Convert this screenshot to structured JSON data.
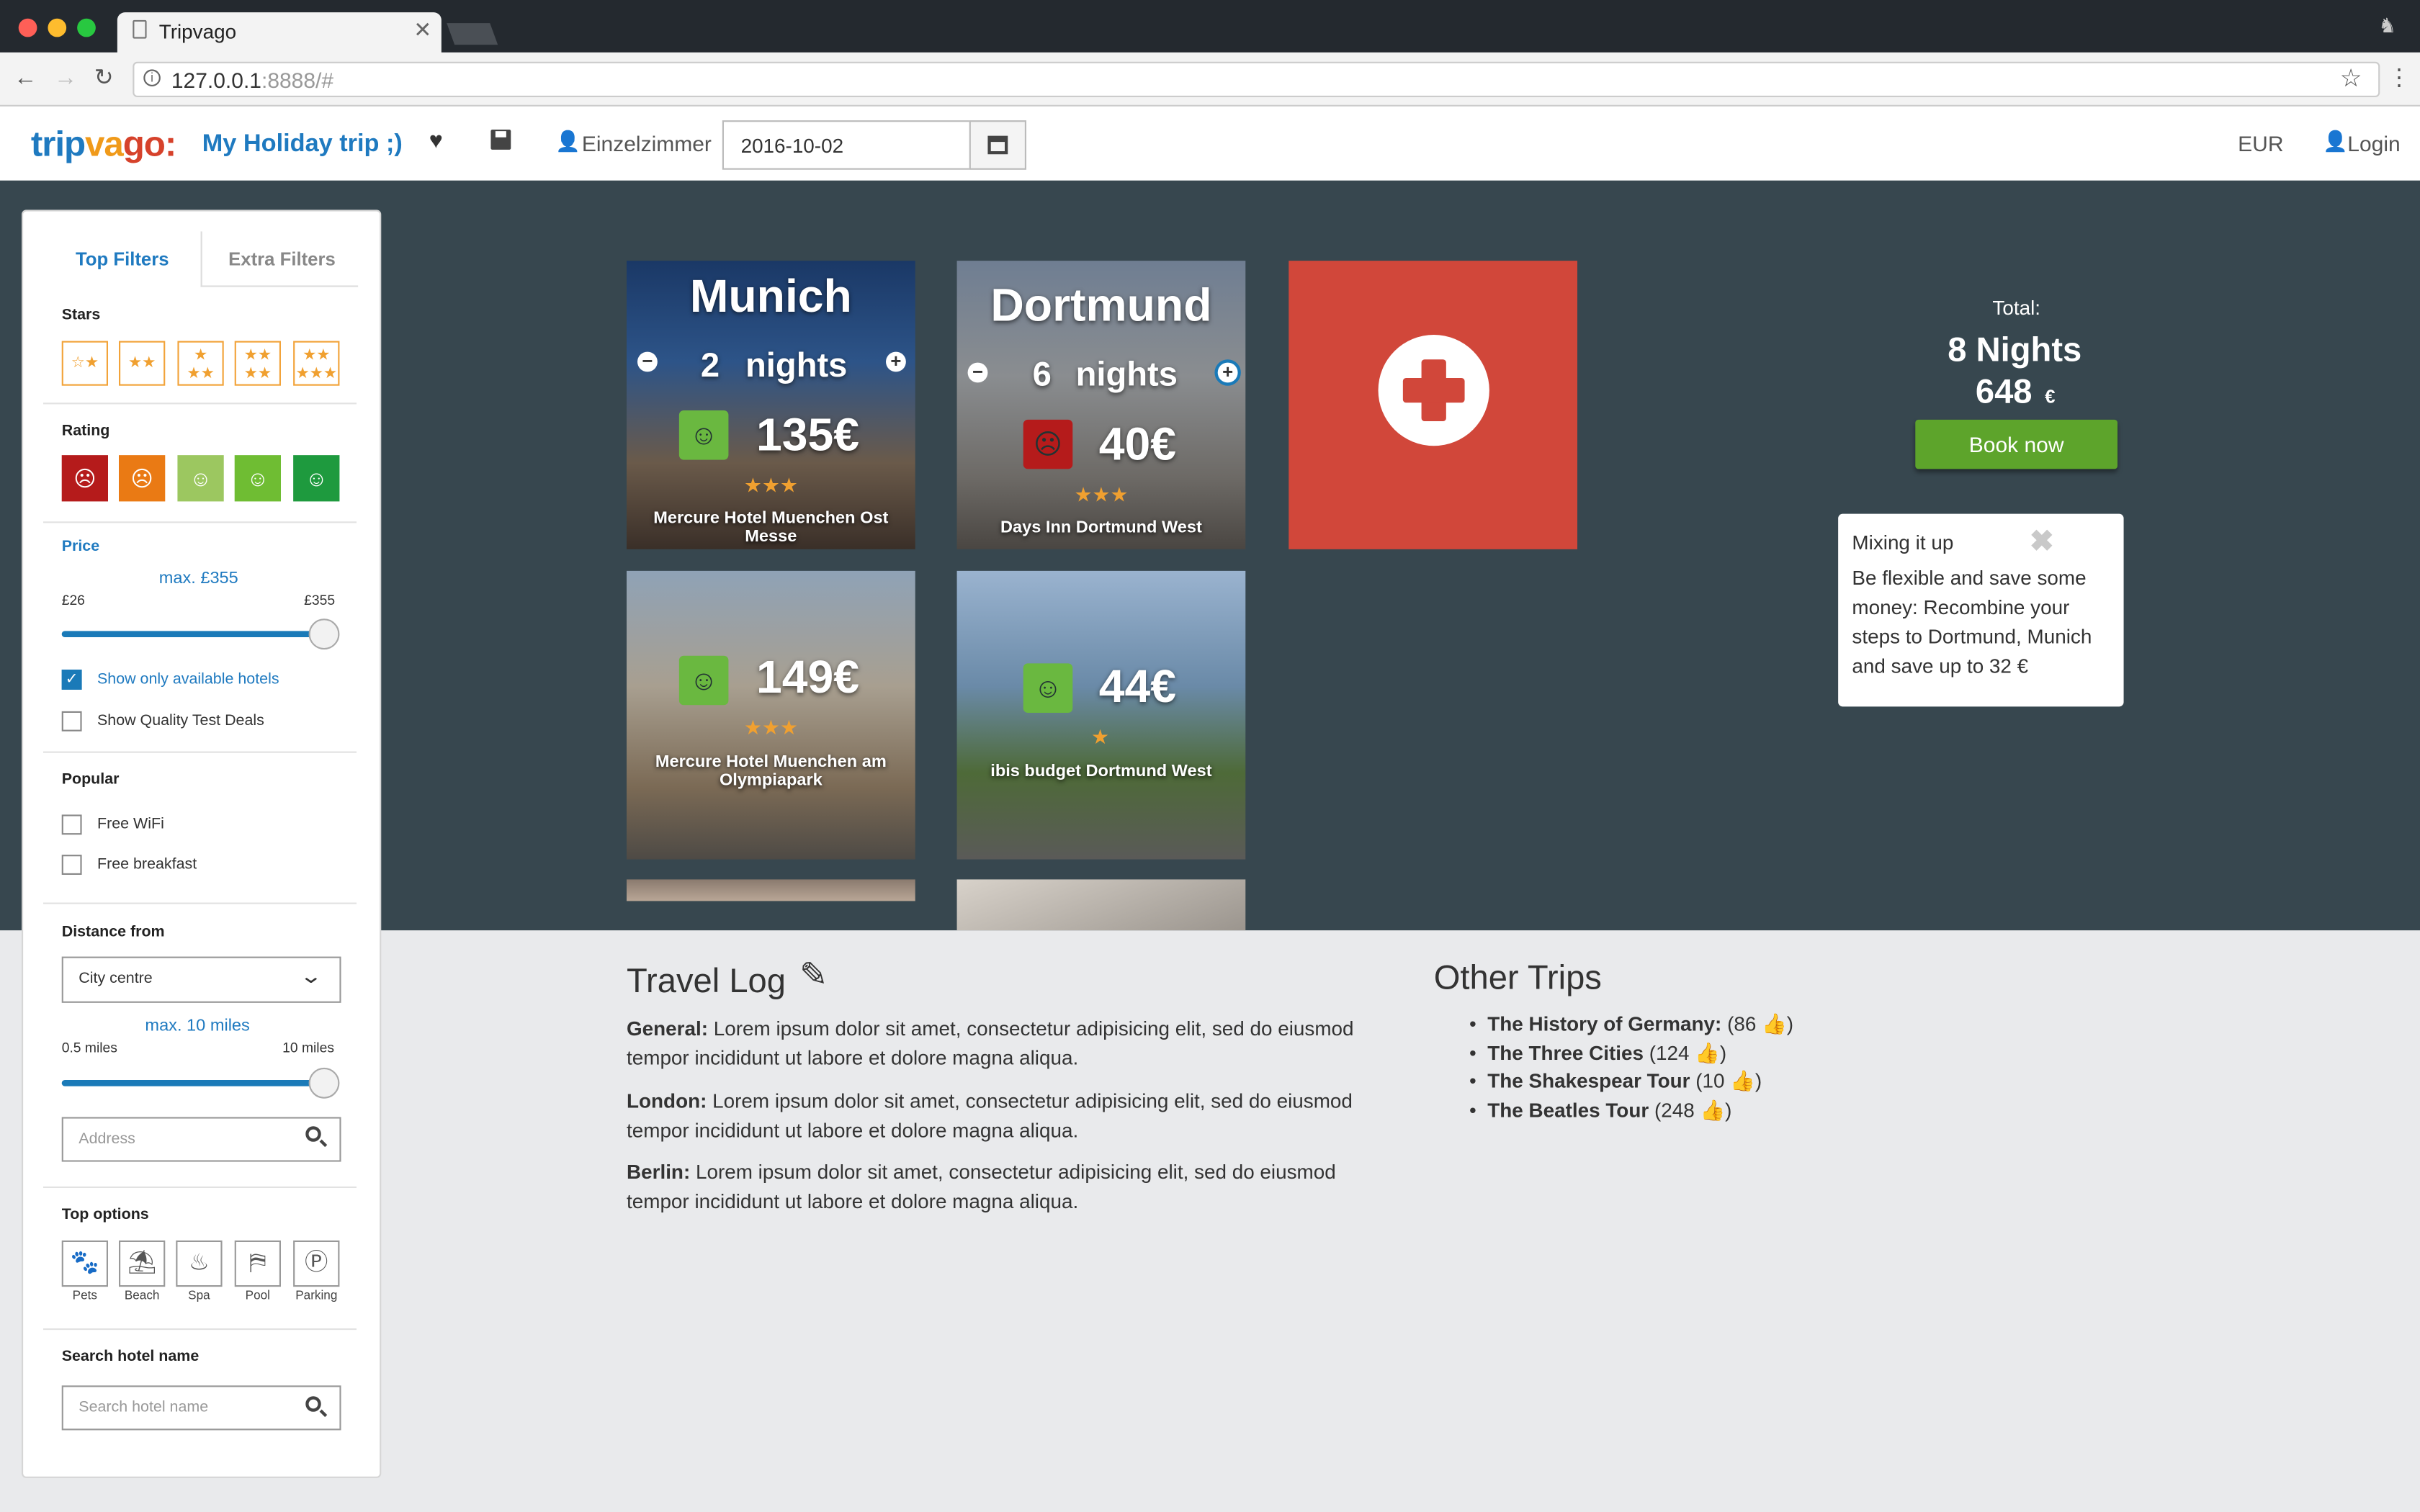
{
  "browser": {
    "tab_title": "Tripvago",
    "url_host": "127.0.0.1",
    "url_rest": ":8888/#"
  },
  "header": {
    "logo_parts": [
      "t",
      "r",
      "i",
      "p",
      "v",
      "a",
      "g",
      "o",
      ":"
    ],
    "logo_colors": [
      "#1f7ac0",
      "#1f7ac0",
      "#1f7ac0",
      "#1f7ac0",
      "#f09a1a",
      "#f09a1a",
      "#d6422b",
      "#d6422b",
      "#d6422b"
    ],
    "trip_title": "My Holiday trip ;)",
    "room_type": "Einzelzimmer",
    "date": "2016-10-02",
    "currency": "EUR",
    "login": "Login"
  },
  "sidebar": {
    "tab_top": "Top Filters",
    "tab_extra": "Extra Filters",
    "stars_label": "Stars",
    "rating_label": "Rating",
    "rating_colors": [
      "#b51b1b",
      "#ea7a14",
      "#9cc760",
      "#6fbd33",
      "#1e9a3e"
    ],
    "price_label": "Price",
    "price_max": "max. £355",
    "price_min_label": "£26",
    "price_max_label": "£355",
    "available_label": "Show only available hotels",
    "quality_label": "Show Quality Test Deals",
    "popular_label": "Popular",
    "wifi_label": "Free WiFi",
    "breakfast_label": "Free breakfast",
    "distance_label": "Distance from",
    "distance_value": "City centre",
    "distance_max": "max. 10 miles",
    "distance_min_label": "0.5 miles",
    "distance_max_label": "10 miles",
    "address_placeholder": "Address",
    "top_options_label": "Top options",
    "options": [
      "Pets",
      "Beach",
      "Spa",
      "Pool",
      "Parking"
    ],
    "search_label": "Search hotel name",
    "search_placeholder": "Search hotel name"
  },
  "cards": [
    {
      "city": "Munich",
      "nights": "2",
      "nights_word": "nights",
      "price": "135€",
      "stars": "★★★",
      "hotel": "Mercure Hotel Muenchen Ost Messe"
    },
    {
      "city": "Dortmund",
      "nights": "6",
      "nights_word": "nights",
      "price": "40€",
      "stars": "★★★",
      "hotel": "Days Inn Dortmund West"
    },
    {
      "price": "149€",
      "stars": "★★★",
      "hotel": "Mercure Hotel Muenchen am Olympiapark"
    },
    {
      "price": "44€",
      "stars": "★",
      "hotel": "ibis budget Dortmund West"
    }
  ],
  "summary": {
    "total_label": "Total:",
    "nights": "8 Nights",
    "amount": "648",
    "currency": "€",
    "book_now": "Book now"
  },
  "tip": {
    "title": "Mixing it up",
    "text": "Be flexible and save some money: Recombine your steps to Dortmund, Munich and save up to 32 €"
  },
  "travel_log": {
    "title": "Travel Log",
    "entries": [
      {
        "place": "General:",
        "text": " Lorem ipsum dolor sit amet, consectetur adipisicing elit, sed do eiusmod tempor incididunt ut labore et dolore magna aliqua."
      },
      {
        "place": "London:",
        "text": " Lorem ipsum dolor sit amet, consectetur adipisicing elit, sed do eiusmod tempor incididunt ut labore et dolore magna aliqua."
      },
      {
        "place": "Berlin:",
        "text": " Lorem ipsum dolor sit amet, consectetur adipisicing elit, sed do eiusmod tempor incididunt ut labore et dolore magna aliqua."
      }
    ]
  },
  "other_trips": {
    "title": "Other Trips",
    "items": [
      {
        "name": "The History of Germany:",
        "likes": " (86 "
      },
      {
        "name": "The Three Cities",
        "likes": " (124 "
      },
      {
        "name": "The Shakespear Tour",
        "likes": " (10 "
      },
      {
        "name": "The Beatles Tour",
        "likes": " (248 "
      }
    ]
  }
}
